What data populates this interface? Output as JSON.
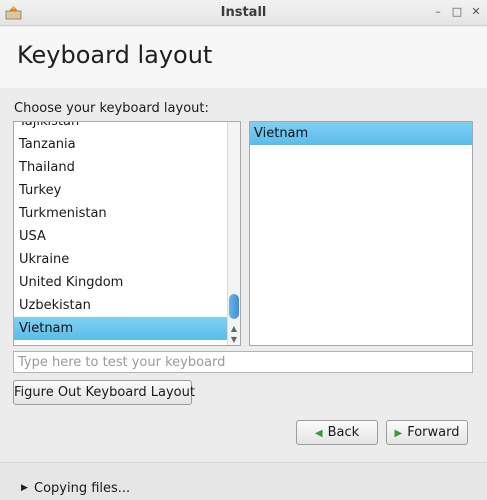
{
  "window": {
    "title": "Install",
    "minimize_glyph": "–",
    "maximize_glyph": "□",
    "close_glyph": "✕"
  },
  "header": {
    "title": "Keyboard layout"
  },
  "prompt": "Choose your keyboard layout:",
  "layout_list": {
    "items": [
      "Tajikistan",
      "Tanzania",
      "Thailand",
      "Turkey",
      "Turkmenistan",
      "USA",
      "Ukraine",
      "United Kingdom",
      "Uzbekistan",
      "Vietnam"
    ],
    "selected": "Vietnam"
  },
  "variant_list": {
    "items": [
      "Vietnam"
    ],
    "selected": "Vietnam"
  },
  "test_input": {
    "placeholder": "Type here to test your keyboard",
    "value": ""
  },
  "buttons": {
    "figure_out": "Figure Out Keyboard Layout",
    "back": "Back",
    "forward": "Forward"
  },
  "footer": {
    "status": "Copying files..."
  },
  "colors": {
    "selection": "#6cc7ef",
    "scroll_thumb": "#4a9ee0",
    "arrow_green": "#3a9a3a"
  }
}
